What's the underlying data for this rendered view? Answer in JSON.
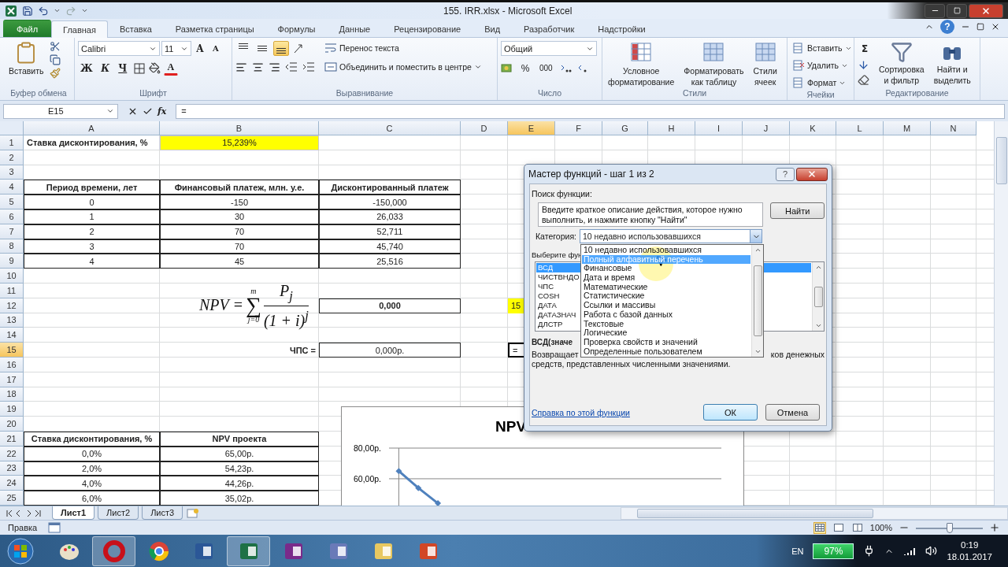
{
  "window": {
    "title": "155. IRR.xlsx - Microsoft Excel"
  },
  "tabs": [
    {
      "label": "Файл",
      "kind": "file",
      "selected": false
    },
    {
      "label": "Главная",
      "kind": "tab",
      "selected": true
    },
    {
      "label": "Вставка",
      "kind": "tab",
      "selected": false
    },
    {
      "label": "Разметка страницы",
      "kind": "tab",
      "selected": false
    },
    {
      "label": "Формулы",
      "kind": "tab",
      "selected": false
    },
    {
      "label": "Данные",
      "kind": "tab",
      "selected": false
    },
    {
      "label": "Рецензирование",
      "kind": "tab",
      "selected": false
    },
    {
      "label": "Вид",
      "kind": "tab",
      "selected": false
    },
    {
      "label": "Разработчик",
      "kind": "tab",
      "selected": false
    },
    {
      "label": "Надстройки",
      "kind": "tab",
      "selected": false
    }
  ],
  "help_button": "?",
  "ribbon": {
    "clipboard": {
      "label": "Буфер обмена",
      "paste": "Вставить"
    },
    "font": {
      "label": "Шрифт",
      "font_name": "Calibri",
      "font_size": "11",
      "grow": "A",
      "shrink": "A",
      "bold": "Ж",
      "italic": "К",
      "underline": "Ч",
      "font_color": "A"
    },
    "alignment": {
      "label": "Выравнивание",
      "vertical": [
        {
          "selected": false
        },
        {
          "selected": false
        },
        {
          "selected": true
        }
      ],
      "wrap_text": "Перенос текста",
      "merge": "Объединить и поместить в центре"
    },
    "number": {
      "label": "Число",
      "format": "Общий",
      "percent": "%",
      "thousands": "000"
    },
    "styles": {
      "label": "Стили",
      "buttons": [
        {
          "lines": [
            "Условное",
            "форматирование"
          ]
        },
        {
          "lines": [
            "Форматировать",
            "как таблицу"
          ]
        },
        {
          "lines": [
            "Стили",
            "ячеек"
          ]
        }
      ]
    },
    "cells": {
      "label": "Ячейки",
      "buttons": [
        "Вставить",
        "Удалить",
        "Формат"
      ]
    },
    "editing": {
      "label": "Редактирование",
      "autosum": "Σ",
      "buttons": [
        {
          "lines": [
            "Сортировка",
            "и фильтр"
          ]
        },
        {
          "lines": [
            "Найти и",
            "выделить"
          ]
        }
      ]
    }
  },
  "formula_bar": {
    "name_box": "E15",
    "function_label": "fx",
    "formula": "="
  },
  "sheet": {
    "columns": [
      {
        "label": "A",
        "selected": false
      },
      {
        "label": "B",
        "selected": false
      },
      {
        "label": "C",
        "selected": false
      },
      {
        "label": "D",
        "selected": false
      },
      {
        "label": "E",
        "selected": true
      },
      {
        "label": "F",
        "selected": false
      },
      {
        "label": "G",
        "selected": false
      },
      {
        "label": "H",
        "selected": false
      },
      {
        "label": "I",
        "selected": false
      },
      {
        "label": "J",
        "selected": false
      },
      {
        "label": "K",
        "selected": false
      },
      {
        "label": "L",
        "selected": false
      },
      {
        "label": "M",
        "selected": false
      },
      {
        "label": "N",
        "selected": false
      }
    ],
    "rows": [
      {
        "header": "1",
        "selected": false,
        "cells": {
          "A": {
            "kind": "title",
            "text": "Ставка дисконтирования, %"
          },
          "B": {
            "kind": "input",
            "text": "15,239%"
          }
        }
      },
      {
        "header": "2",
        "selected": false
      },
      {
        "header": "3",
        "selected": false
      },
      {
        "header": "4",
        "selected": false,
        "cells": {
          "A": {
            "kind": "header",
            "text": "Период времени, лет"
          },
          "B": {
            "kind": "header",
            "text": "Финансовый платеж, млн. у.е."
          },
          "C": {
            "kind": "header",
            "text": "Дисконтированный платеж"
          }
        }
      },
      {
        "header": "5",
        "selected": false,
        "cells": {
          "A": {
            "kind": "value",
            "text": "0"
          },
          "B": {
            "kind": "value",
            "text": "-150"
          },
          "C": {
            "kind": "value",
            "text": "-150,000"
          }
        }
      },
      {
        "header": "6",
        "selected": false,
        "cells": {
          "A": {
            "kind": "value",
            "text": "1"
          },
          "B": {
            "kind": "value",
            "text": "30"
          },
          "C": {
            "kind": "value",
            "text": "26,033"
          }
        }
      },
      {
        "header": "7",
        "selected": false,
        "cells": {
          "A": {
            "kind": "value",
            "text": "2"
          },
          "B": {
            "kind": "value",
            "text": "70"
          },
          "C": {
            "kind": "value",
            "text": "52,711"
          }
        }
      },
      {
        "header": "8",
        "selected": false,
        "cells": {
          "A": {
            "kind": "value",
            "text": "3"
          },
          "B": {
            "kind": "value",
            "text": "70"
          },
          "C": {
            "kind": "value",
            "text": "45,740"
          }
        }
      },
      {
        "header": "9",
        "selected": false,
        "cells": {
          "A": {
            "kind": "value",
            "text": "4"
          },
          "B": {
            "kind": "value",
            "text": "45"
          },
          "C": {
            "kind": "value",
            "text": "25,516"
          }
        }
      },
      {
        "header": "10",
        "selected": false
      },
      {
        "header": "11",
        "selected": false
      },
      {
        "header": "12",
        "selected": false,
        "cells": {
          "C": {
            "kind": "total",
            "text": "0,000"
          },
          "E": {
            "kind": "partial",
            "text": "15"
          }
        }
      },
      {
        "header": "13",
        "selected": false
      },
      {
        "header": "14",
        "selected": false
      },
      {
        "header": "15",
        "selected": true,
        "cells": {
          "B": {
            "kind": "caption",
            "text": "ЧПС ="
          },
          "C": {
            "kind": "value",
            "text": "0,000р."
          },
          "E": {
            "kind": "active",
            "text": "="
          }
        }
      },
      {
        "header": "16",
        "selected": false
      },
      {
        "header": "17",
        "selected": false
      },
      {
        "header": "18",
        "selected": false
      },
      {
        "header": "19",
        "selected": false
      },
      {
        "header": "20",
        "selected": false
      },
      {
        "header": "21",
        "selected": false,
        "cells": {
          "A": {
            "kind": "header",
            "text": "Ставка дисконтирования, %"
          },
          "B": {
            "kind": "header",
            "text": "NPV проекта"
          }
        }
      },
      {
        "header": "22",
        "selected": false,
        "cells": {
          "A": {
            "kind": "value",
            "text": "0,0%"
          },
          "B": {
            "kind": "value",
            "text": "65,00р."
          }
        }
      },
      {
        "header": "23",
        "selected": false,
        "cells": {
          "A": {
            "kind": "value",
            "text": "2,0%"
          },
          "B": {
            "kind": "value",
            "text": "54,23р."
          }
        }
      },
      {
        "header": "24",
        "selected": false,
        "cells": {
          "A": {
            "kind": "value",
            "text": "4,0%"
          },
          "B": {
            "kind": "value",
            "text": "44,26р."
          }
        }
      },
      {
        "header": "25",
        "selected": false,
        "cells": {
          "A": {
            "kind": "value",
            "text": "6,0%"
          },
          "B": {
            "kind": "value",
            "text": "35,02р."
          }
        }
      }
    ],
    "formula_object": {
      "lhs": "NPV =",
      "sum_top": "m",
      "sum_sign": "∑",
      "sum_bottom": "j=0",
      "numerator": "P$_{j}$",
      "denominator": "(1 + i)$^{j}$"
    },
    "chart": {
      "chart_data": {
        "type": "line",
        "title": "NPV",
        "categories": [
          null,
          null,
          null,
          null,
          null,
          null,
          null,
          null,
          null,
          null,
          null,
          null,
          null,
          null,
          null,
          null,
          null
        ],
        "ylim": [
          42,
          80
        ],
        "yticks": [
          {
            "value": 60,
            "label": "60,00р."
          },
          {
            "value": 80,
            "label": "80,00р."
          }
        ],
        "series": [
          {
            "color": "#4f81bd",
            "marker": "diamond",
            "values": [
              65,
              54,
              44,
              null,
              null,
              null,
              null,
              null,
              null,
              null,
              null,
              null,
              null,
              null,
              null,
              null,
              null
            ]
          }
        ]
      }
    }
  },
  "sheet_tabs": [
    {
      "label": "Лист1",
      "selected": true
    },
    {
      "label": "Лист2",
      "selected": false
    },
    {
      "label": "Лист3",
      "selected": false
    }
  ],
  "status_bar": {
    "mode": "Правка",
    "views": [
      {
        "selected": true
      },
      {
        "selected": false
      },
      {
        "selected": false
      }
    ],
    "zoom": "100%",
    "zoom_slider": {
      "level": 0.5
    }
  },
  "dialog": {
    "title": "Мастер функций - шаг 1 из 2",
    "help": "?",
    "search_label": "Поиск функции:",
    "search_text": "Введите краткое описание действия, которое нужно выполнить, и нажмите кнопку \"Найти\"",
    "find_button": "Найти",
    "category_label": "Категория:",
    "category_value": "10 недавно использовавшихся",
    "select_label": "Выберите фун",
    "functions": [
      {
        "name": "ВСД",
        "selected": true
      },
      {
        "name": "ЧИСТВНДО",
        "selected": false
      },
      {
        "name": "ЧПС",
        "selected": false
      },
      {
        "name": "COSH",
        "selected": false
      },
      {
        "name": "ДАТА",
        "selected": false
      },
      {
        "name": "ДАТАЗНАЧ",
        "selected": false
      },
      {
        "name": "ДЛСТР",
        "selected": false
      }
    ],
    "signature": "ВСД(значе",
    "description_start": "Возвращает",
    "description_end": "ков денежных",
    "description_line2": "средств, представленных численными значениями.",
    "help_link": "Справка по этой функции",
    "ok": "ОК",
    "cancel": "Отмена",
    "category_options": [
      {
        "label": "10 недавно использовавшихся",
        "selected": false
      },
      {
        "label": "Полный алфавитный перечень",
        "selected": true
      },
      {
        "label": "Финансовые",
        "selected": false
      },
      {
        "label": "Дата и время",
        "selected": false
      },
      {
        "label": "Математические",
        "selected": false
      },
      {
        "label": "Статистические",
        "selected": false
      },
      {
        "label": "Ссылки и массивы",
        "selected": false
      },
      {
        "label": "Работа с базой данных",
        "selected": false
      },
      {
        "label": "Текстовые",
        "selected": false
      },
      {
        "label": "Логические",
        "selected": false
      },
      {
        "label": "Проверка свойств и значений",
        "selected": false
      },
      {
        "label": "Определенные пользователем",
        "selected": false
      }
    ]
  },
  "taskbar": {
    "apps": [
      {
        "active": false
      },
      {
        "active": true
      },
      {
        "active": false
      },
      {
        "active": false
      },
      {
        "active": true
      },
      {
        "active": false
      },
      {
        "active": false
      },
      {
        "active": false
      },
      {
        "active": false
      }
    ],
    "language": "EN",
    "battery": "97%",
    "time": "0:19",
    "date": "18.01.2017"
  }
}
